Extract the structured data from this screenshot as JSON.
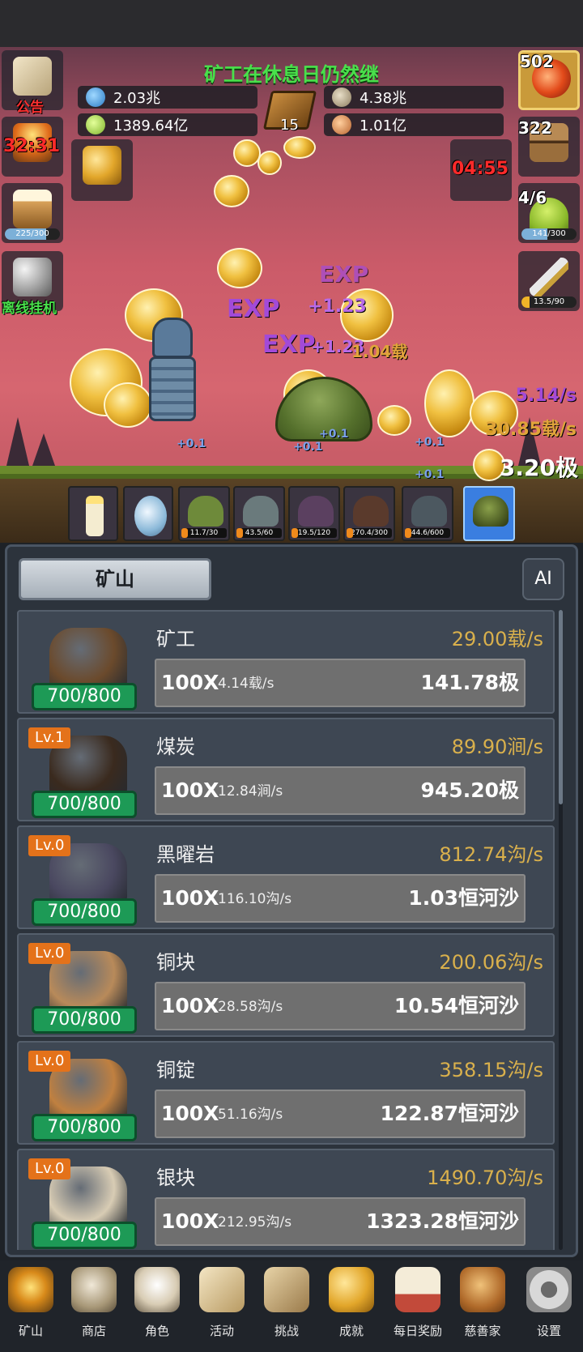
{
  "ticker": "矿工在休息日仍然继",
  "resources": {
    "blue": "2.03兆",
    "green": "1389.64亿",
    "stone": "4.38兆",
    "meat": "1.01亿",
    "book_count": "15"
  },
  "left_buttons": {
    "notice": "公告",
    "timer": "32:31",
    "beer_progress": "225/300",
    "beer_fraction": 0.75,
    "offline": "离线挂机"
  },
  "right_buttons": {
    "potion_count": "502",
    "chest_count": "322",
    "chest_timer": "04:55",
    "slime_count": "4/6",
    "slime_progress": "141/300",
    "slime_fraction": 0.47,
    "sword_progress": "13.5/90",
    "sword_fraction": 0.15
  },
  "scene": {
    "exp_label": "EXP",
    "exp_a": "+1.23",
    "exp_b": "+1.23",
    "yield": "1.04载",
    "rate_1": "5.14/s",
    "rate_2": "30.85载/s",
    "total": "3.20极",
    "plus": "+0.1"
  },
  "mobs": [
    {
      "count": "11.7/30",
      "color": "#6e8a3a"
    },
    {
      "count": "43.5/60",
      "color": "#6a7a7c"
    },
    {
      "count": "19.5/120",
      "color": "#5b4060"
    },
    {
      "count": "270.4/300",
      "color": "#5a3a2c"
    },
    {
      "count": "44.6/600",
      "color": "#4c5860"
    }
  ],
  "panel": {
    "tab": "矿山",
    "ai": "AI"
  },
  "rows": [
    {
      "name": "矿工",
      "level": "",
      "rate": "29.00载/s",
      "cap": "700/800",
      "mult": "100X",
      "inc": "4.14载/s",
      "cost": "141.78极",
      "color": "#6b4a2c"
    },
    {
      "name": "煤炭",
      "level": "Lv.1",
      "rate": "89.90涧/s",
      "cap": "700/800",
      "mult": "100X",
      "inc": "12.84涧/s",
      "cost": "945.20极",
      "color": "#3a2a1e"
    },
    {
      "name": "黑曜岩",
      "level": "Lv.0",
      "rate": "812.74沟/s",
      "cap": "700/800",
      "mult": "100X",
      "inc": "116.10沟/s",
      "cost": "1.03恒河沙",
      "color": "#4a4860"
    },
    {
      "name": "铜块",
      "level": "Lv.0",
      "rate": "200.06沟/s",
      "cap": "700/800",
      "mult": "100X",
      "inc": "28.58沟/s",
      "cost": "10.54恒河沙",
      "color": "#b88a5a"
    },
    {
      "name": "铜锭",
      "level": "Lv.0",
      "rate": "358.15沟/s",
      "cap": "700/800",
      "mult": "100X",
      "inc": "51.16沟/s",
      "cost": "122.87恒河沙",
      "color": "#c08040"
    },
    {
      "name": "银块",
      "level": "Lv.0",
      "rate": "1490.70沟/s",
      "cap": "700/800",
      "mult": "100X",
      "inc": "212.95沟/s",
      "cost": "1323.28恒河沙",
      "color": "#d8ccb4"
    }
  ],
  "nav": [
    "矿山",
    "商店",
    "角色",
    "活动",
    "挑战",
    "成就",
    "每日奖励",
    "慈善家",
    "设置"
  ]
}
